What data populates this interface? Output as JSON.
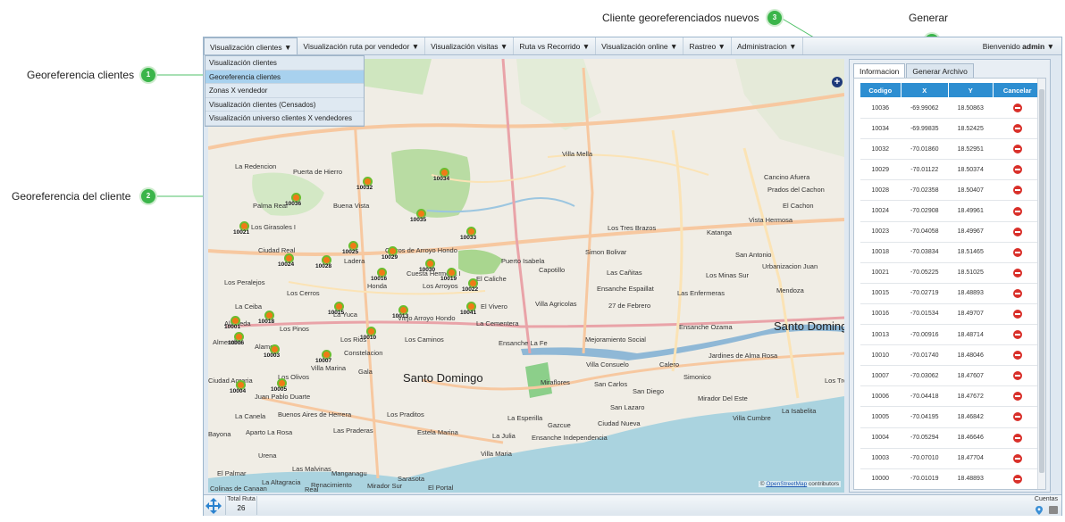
{
  "callouts": [
    {
      "num": "1",
      "label": "Georeferencia clientes"
    },
    {
      "num": "2",
      "label": "Georeferencia del cliente"
    },
    {
      "num": "3",
      "label": "Cliente georeferenciados nuevos"
    },
    {
      "num": "4",
      "label": "Generar"
    }
  ],
  "menu": {
    "items": [
      "Visualización clientes ▼",
      "Visualización ruta por vendedor ▼",
      "Visualización visitas ▼",
      "Ruta vs Recorrido ▼",
      "Visualización online ▼",
      "Rastreo ▼",
      "Administracion ▼"
    ],
    "welcome_prefix": "Bienvenido",
    "user": "admin",
    "welcome_arrow": "▼"
  },
  "dropdown": {
    "items": [
      "Visualización clientes",
      "Georeferencia clientes",
      "Zonas X vendedor",
      "Visualización clientes (Censados)",
      "Visualización universo clientes X vendedores"
    ],
    "selected_index": 1
  },
  "map": {
    "places": [
      "La Redencion",
      "Puerta de Hierro",
      "Villa Mella",
      "Palma Real",
      "Buena Vista",
      "Los Girasoles I",
      "Cancino Afuera",
      "Prados del Cachon",
      "El Cachon",
      "Vista Hermosa",
      "Los Tres Brazos",
      "Katanga",
      "Ciudad Real",
      "Ladera",
      "Cerros de Arroyo Hondo",
      "Puerto Isabela",
      "Simon Bolivar",
      "San Antonio",
      "Urbanizacion Juan",
      "Cuesta Hermosa I",
      "El Caliche",
      "Capotillo",
      "Las Cañitas",
      "Los Minas Sur",
      "Los Peralejos",
      "Los Cerros",
      "Honda",
      "Los Arroyos",
      "Ensanche Espaillat",
      "Las Enfermeras",
      "Mendoza",
      "La Ceiba",
      "La Yuca",
      "Viejo Arroyo Hondo",
      "El Vivero",
      "Villa Agricolas",
      "27 de Febrero",
      "Alameda",
      "Los Pinos",
      "La Cementera",
      "Ensanche Ozama",
      "Santo Domingo",
      "Almendra",
      "Alamo",
      "Los Rios",
      "Los Caminos",
      "Mejoramiento Social",
      "Jardines de Alma Rosa",
      "Constelacion",
      "Ensanche La Fe",
      "Villa Marina",
      "Villa Consuelo",
      "Calero",
      "Ciudad Agraria",
      "Los Olivos",
      "Gala",
      "Santo Domingo",
      "Miraflores",
      "San Carlos",
      "San Diego",
      "Simonico",
      "Los Tres",
      "Juan Pablo Duarte",
      "Mirador Del Este",
      "San Lazaro",
      "La Isabelita",
      "La Canela",
      "Buenos Aires de Herrera",
      "Los Praditos",
      "La Esperilla",
      "Villa Cumbre",
      "Bayona",
      "Aparto La Rosa",
      "Las Praderas",
      "Estela Marina",
      "Gazcue",
      "Ciudad Nueva",
      "La Julia",
      "Ensanche Independencia",
      "Urena",
      "Villa Maria",
      "El Palmar",
      "Las Malvinas",
      "Manganagu",
      "Sarasota",
      "La Altagracia",
      "Renacimiento",
      "Mirador Sur",
      "El Portal",
      "Colinas de Canaan",
      "Real",
      "Ensanche Ozama"
    ],
    "pins": [
      "10034",
      "10032",
      "10036",
      "10035",
      "10021",
      "10033",
      "10025",
      "10029",
      "10028",
      "10024",
      "10030",
      "10016",
      "10019",
      "10022",
      "10018",
      "10015",
      "10013",
      "10041",
      "10001",
      "10010",
      "10007",
      "10003",
      "10004",
      "10005",
      "10006"
    ],
    "attribution_prefix": "©",
    "attribution_link": "OpenStreetMap",
    "attribution_suffix": "contributors"
  },
  "panel": {
    "tabs": [
      "Informacion",
      "Generar Archivo"
    ],
    "columns": [
      "Codigo",
      "X",
      "Y",
      "Cancelar"
    ],
    "rows": [
      [
        "10036",
        "-69.99062",
        "18.50863"
      ],
      [
        "10034",
        "-69.99835",
        "18.52425"
      ],
      [
        "10032",
        "-70.01860",
        "18.52951"
      ],
      [
        "10029",
        "-70.01122",
        "18.50374"
      ],
      [
        "10028",
        "-70.02358",
        "18.50407"
      ],
      [
        "10024",
        "-70.02908",
        "18.49961"
      ],
      [
        "10023",
        "-70.04058",
        "18.49967"
      ],
      [
        "10018",
        "-70.03834",
        "18.51465"
      ],
      [
        "10021",
        "-70.05225",
        "18.51025"
      ],
      [
        "10015",
        "-70.02719",
        "18.48893"
      ],
      [
        "10016",
        "-70.01534",
        "18.49707"
      ],
      [
        "10013",
        "-70.00916",
        "18.48714"
      ],
      [
        "10010",
        "-70.01740",
        "18.48046"
      ],
      [
        "10007",
        "-70.03062",
        "18.47607"
      ],
      [
        "10006",
        "-70.04418",
        "18.47672"
      ],
      [
        "10005",
        "-70.04195",
        "18.46842"
      ],
      [
        "10004",
        "-70.05294",
        "18.46646"
      ],
      [
        "10003",
        "-70.07010",
        "18.47704"
      ],
      [
        "10000",
        "-70.01019",
        "18.48893"
      ]
    ]
  },
  "status": {
    "total_label": "Total Ruta",
    "total_value": "26",
    "cuentas_label": "Cuentas"
  },
  "colors": {
    "accent": "#2d8ed1",
    "callout": "#3bb54a",
    "pin_fill": "#f07a16",
    "pin_ring": "#6bbd2e",
    "cancel": "#d9302a"
  }
}
